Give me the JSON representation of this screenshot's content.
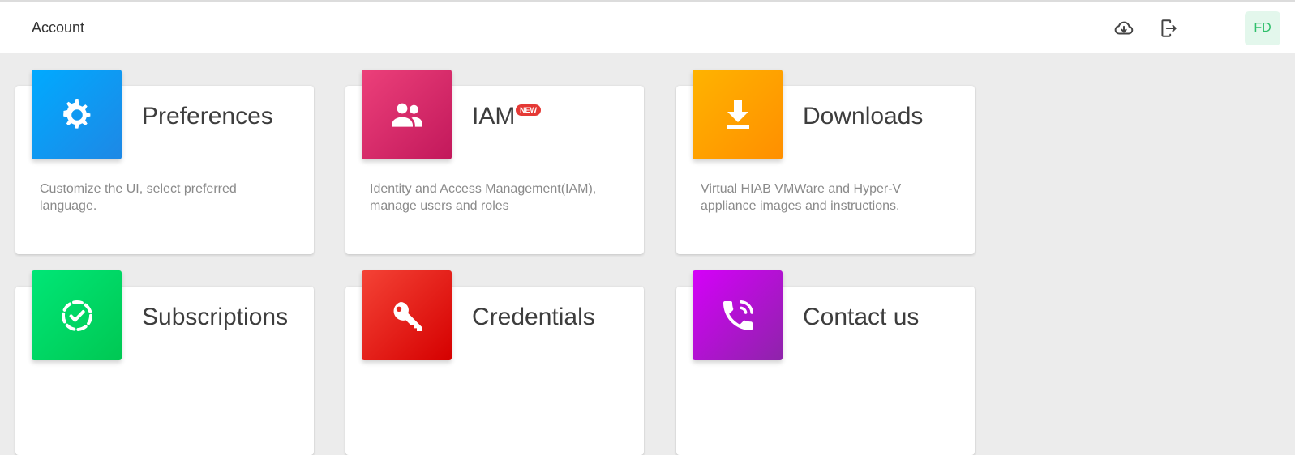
{
  "header": {
    "title": "Account",
    "avatar_initials": "FD",
    "icons": [
      "cloud-download-icon",
      "logout-icon"
    ]
  },
  "colors": {
    "background": "#ececec",
    "avatar_bg": "#e3f7ec",
    "avatar_text": "#2fbf6b",
    "badge": "#e53935"
  },
  "cards": [
    {
      "title": "Preferences",
      "description": "Customize the UI, select preferred language.",
      "icon": "gear-icon",
      "gradient": [
        "#00aaff",
        "#1e88e5"
      ]
    },
    {
      "title": "IAM",
      "badge": "NEW",
      "description": "Identity and Access Management(IAM), manage users and roles",
      "icon": "users-icon",
      "gradient": [
        "#ec407a",
        "#c2185b"
      ]
    },
    {
      "title": "Downloads",
      "description": "Virtual HIAB VMWare and Hyper-V appliance images and instructions.",
      "icon": "download-icon",
      "gradient": [
        "#ffb300",
        "#ff8f00"
      ]
    },
    {
      "title": "Subscriptions",
      "icon": "subscription-check-icon",
      "gradient": [
        "#00e676",
        "#00c853"
      ]
    },
    {
      "title": "Credentials",
      "icon": "key-icon",
      "gradient": [
        "#f44336",
        "#d50000"
      ]
    },
    {
      "title": "Contact us",
      "icon": "phone-call-icon",
      "gradient": [
        "#d500f9",
        "#8e24aa"
      ]
    }
  ]
}
